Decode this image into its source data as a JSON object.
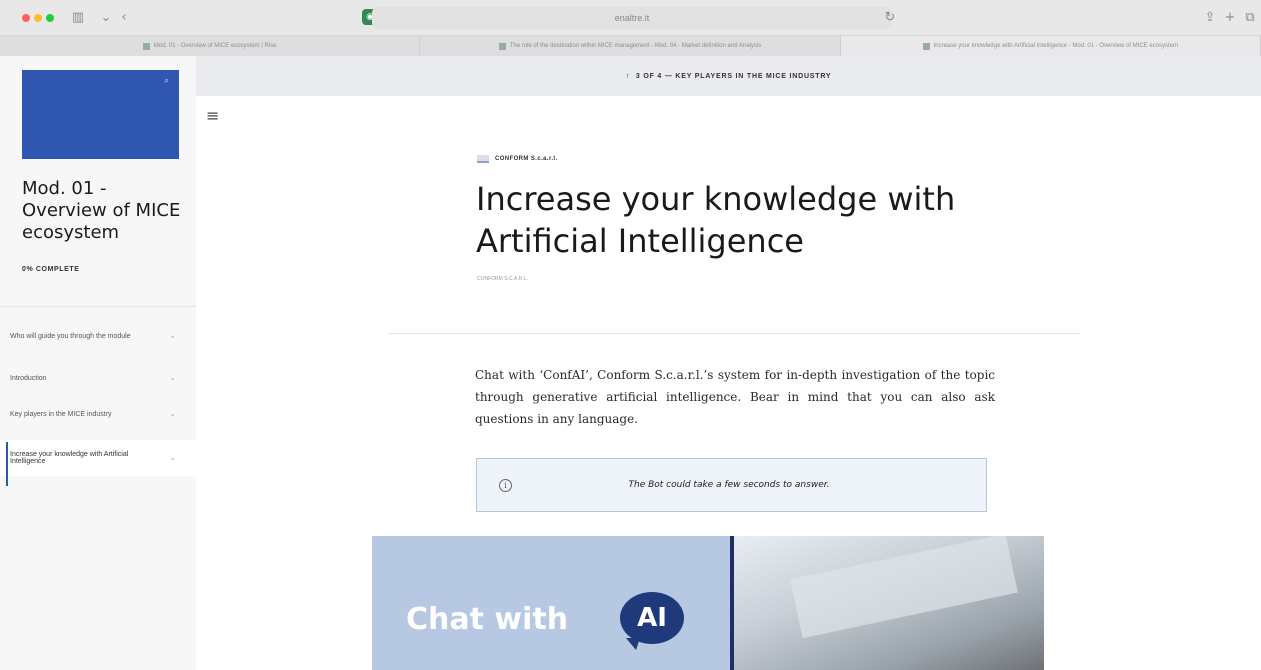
{
  "browser": {
    "url": "enaltre.it",
    "tabs": [
      {
        "label": "Mod. 01 - Overview of MICE ecosystem | Rise"
      },
      {
        "label": "The role of the destination within MICE management - Mod. 04 - Market definition and Analysis"
      },
      {
        "label": "Increase your knowledge with Artificial Intelligence - Mod. 01 - Overview of MICE ecosystem"
      }
    ],
    "active_tab": 2
  },
  "banner": {
    "arrow": "↑",
    "text": "3 OF 4 — KEY PLAYERS IN THE MICE INDUSTRY"
  },
  "sidebar": {
    "course_title": "Mod. 01 - Overview of MICE ecosystem",
    "progress": "0% COMPLETE",
    "items": [
      {
        "label": "Who will guide you through the module"
      },
      {
        "label": "Introduction"
      },
      {
        "label": "Key players in the MICE industry"
      },
      {
        "label": "Increase your knowledge with Artificial Intelligence"
      }
    ],
    "active_item": 3
  },
  "lesson": {
    "author": "CONFORM S.c.a.r.l.",
    "title": "Increase your knowledge with Artificial Intelligence",
    "byline": "CONFORM S.C.A.R.L.",
    "body": "Chat with ‘ConfAI’, Conform S.c.a.r.l.’s system for in-depth investigation of the topic through generative artificial intelligence. Bear in mind that you can also ask questions in any language.",
    "callout": "The Bot could take a few seconds to answer."
  },
  "hero": {
    "text": "Chat with",
    "badge": "AI"
  },
  "colors": {
    "accent": "#2f56b0",
    "callout_bg": "#eef2f9",
    "hero_blue": "#b7c8e2",
    "badge_navy": "#1f3a7a"
  }
}
